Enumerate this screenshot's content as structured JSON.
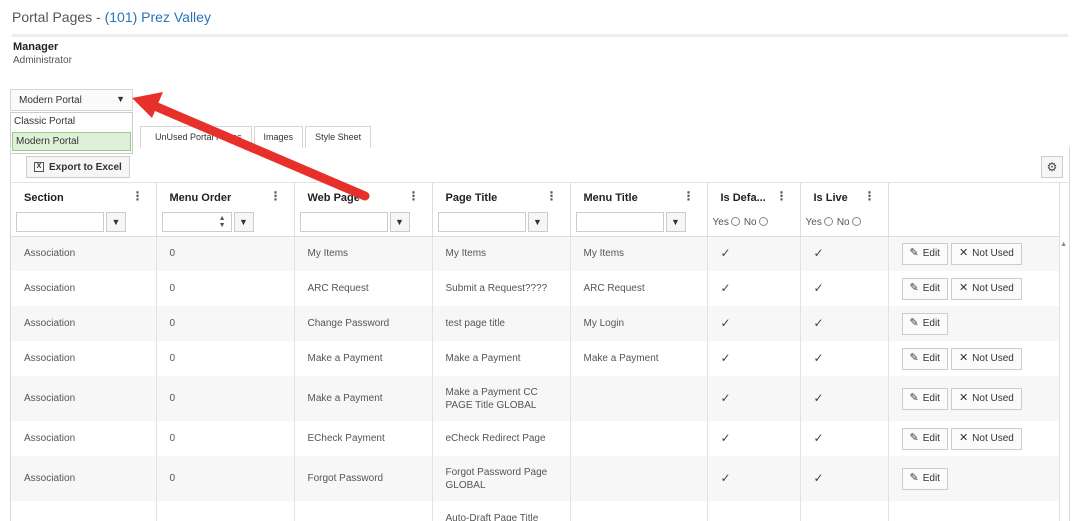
{
  "page": {
    "title_prefix": "Portal Pages - ",
    "community": "(101) Prez Valley"
  },
  "user": {
    "name": "Manager",
    "role": "Administrator"
  },
  "portal_select": {
    "value": "Modern Portal",
    "options": [
      "Classic Portal",
      "Modern Portal"
    ]
  },
  "tabs": [
    "UnUsed Portal Pages",
    "Images",
    "Style Sheet"
  ],
  "toolbar": {
    "export_label": "Export to Excel",
    "excel_glyph": "X"
  },
  "columns": [
    "Section",
    "Menu Order",
    "Web Page",
    "Page Title",
    "Menu Title",
    "Is Defa...",
    "Is Live"
  ],
  "filter": {
    "yes": "Yes",
    "no": "No"
  },
  "actions": {
    "edit": "Edit",
    "not_used": "Not Used"
  },
  "rows": [
    {
      "section": "Association",
      "order": "0",
      "web_page": "My Items",
      "page_title": "My Items",
      "menu_title": "My Items",
      "is_default": true,
      "is_live": true,
      "not_used": true
    },
    {
      "section": "Association",
      "order": "0",
      "web_page": "ARC Request",
      "page_title": "Submit a Request????",
      "menu_title": "ARC Request",
      "is_default": true,
      "is_live": true,
      "not_used": true
    },
    {
      "section": "Association",
      "order": "0",
      "web_page": "Change Password",
      "page_title": "test page title",
      "menu_title": "My Login",
      "is_default": true,
      "is_live": true,
      "not_used": false
    },
    {
      "section": "Association",
      "order": "0",
      "web_page": "Make a Payment",
      "page_title": "Make a Payment",
      "menu_title": "Make a Payment",
      "is_default": true,
      "is_live": true,
      "not_used": true
    },
    {
      "section": "Association",
      "order": "0",
      "web_page": "Make a Payment",
      "page_title": "Make a Payment CC PAGE Title GLOBAL",
      "menu_title": "",
      "is_default": true,
      "is_live": true,
      "not_used": true
    },
    {
      "section": "Association",
      "order": "0",
      "web_page": "ECheck Payment",
      "page_title": "eCheck Redirect Page",
      "menu_title": "",
      "is_default": true,
      "is_live": true,
      "not_used": true
    },
    {
      "section": "Association",
      "order": "0",
      "web_page": "Forgot Password",
      "page_title": "Forgot Password Page GLOBAL",
      "menu_title": "",
      "is_default": true,
      "is_live": true,
      "not_used": false
    },
    {
      "section": "",
      "order": "",
      "web_page": "",
      "page_title": "Auto-Draft Page Title",
      "menu_title": "",
      "is_default": false,
      "is_live": false,
      "not_used": false
    }
  ],
  "icons": {
    "caret": "caret-down-icon",
    "filter": "filter-icon",
    "kebab": "kebab-menu-icon",
    "check": "check-icon",
    "pencil": "pencil-icon",
    "close": "x-icon",
    "gear": "gear-icon",
    "arrow": "red-arrow-annotation"
  },
  "colors": {
    "link": "#2a73b6",
    "selected_option": "#dff0d8",
    "annotation_arrow": "#e8302a"
  }
}
